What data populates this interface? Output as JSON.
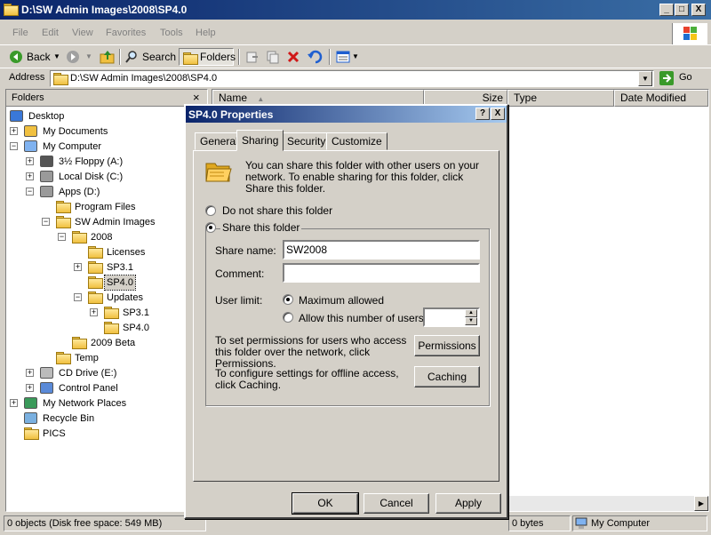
{
  "window": {
    "title": "D:\\SW Admin Images\\2008\\SP4.0",
    "minimize": "_",
    "maximize": "□",
    "close": "X"
  },
  "menu": [
    "File",
    "Edit",
    "View",
    "Favorites",
    "Tools",
    "Help"
  ],
  "toolbar": {
    "back": "Back",
    "search": "Search",
    "folders": "Folders"
  },
  "address": {
    "label": "Address",
    "value": "D:\\SW Admin Images\\2008\\SP4.0",
    "go": "Go"
  },
  "folders_pane": {
    "title": "Folders",
    "close": "×",
    "items": [
      {
        "label": "Desktop",
        "icon": "desktop-icon"
      },
      {
        "label": "My Documents",
        "icon": "my-documents-icon"
      },
      {
        "label": "My Computer",
        "icon": "my-computer-icon"
      },
      {
        "label": "3½ Floppy (A:)",
        "icon": "floppy-icon"
      },
      {
        "label": "Local Disk (C:)",
        "icon": "disk-icon"
      },
      {
        "label": "Apps (D:)",
        "icon": "disk-icon"
      },
      {
        "label": "Program Files",
        "icon": "folder-icon"
      },
      {
        "label": "SW Admin Images",
        "icon": "folder-icon"
      },
      {
        "label": "2008",
        "icon": "folder-icon"
      },
      {
        "label": "Licenses",
        "icon": "folder-icon"
      },
      {
        "label": "SP3.1",
        "icon": "folder-icon"
      },
      {
        "label": "SP4.0",
        "icon": "folder-icon"
      },
      {
        "label": "Updates",
        "icon": "folder-icon"
      },
      {
        "label": "SP3.1",
        "icon": "folder-icon"
      },
      {
        "label": "SP4.0",
        "icon": "folder-icon"
      },
      {
        "label": "2009 Beta",
        "icon": "folder-icon"
      },
      {
        "label": "Temp",
        "icon": "folder-icon"
      },
      {
        "label": "CD Drive (E:)",
        "icon": "cd-drive-icon"
      },
      {
        "label": "Control Panel",
        "icon": "control-panel-icon"
      },
      {
        "label": "My Network Places",
        "icon": "network-icon"
      },
      {
        "label": "Recycle Bin",
        "icon": "recycle-bin-icon"
      },
      {
        "label": "PICS",
        "icon": "folder-icon"
      }
    ]
  },
  "list": {
    "columns": [
      "Name",
      "Size",
      "Type",
      "Date Modified"
    ]
  },
  "status": {
    "objects": "0 objects (Disk free space: 549 MB)",
    "bytes": "0 bytes",
    "zone": "My Computer"
  },
  "dialog": {
    "title": "SP4.0 Properties",
    "help": "?",
    "close": "X",
    "tabs": [
      "General",
      "Sharing",
      "Security",
      "Customize"
    ],
    "active_tab": "Sharing",
    "intro": "You can share this folder with other users on your network.  To enable sharing for this folder, click Share this folder.",
    "do_not_share": "Do not share this folder",
    "share_this": "Share this folder",
    "share_name_label": "Share name:",
    "share_name_value": "SW2008",
    "comment_label": "Comment:",
    "comment_value": "",
    "user_limit_label": "User limit:",
    "max_allowed": "Maximum allowed",
    "allow_number": "Allow this number of users:",
    "permissions_text": "To set permissions for users who access this folder over the network, click Permissions.",
    "permissions_button": "Permissions",
    "caching_text": "To configure settings for offline access, click Caching.",
    "caching_button": "Caching",
    "ok": "OK",
    "cancel": "Cancel",
    "apply": "Apply"
  },
  "colors": {
    "title_active": "#0a246a",
    "face": "#d4d0c8",
    "selected_item_bg": "#d4d0c8"
  }
}
